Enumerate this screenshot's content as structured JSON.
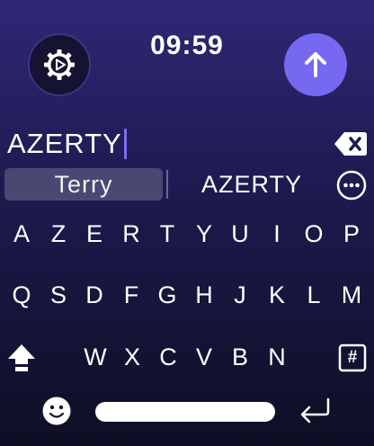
{
  "status": {
    "time": "09:59"
  },
  "toolbar": {
    "settings_icon": "gear-play-icon",
    "send_icon": "arrow-up-icon",
    "accent": "#7668f0"
  },
  "input": {
    "text": "AZERTY",
    "cursor_color": "#7c6df2"
  },
  "suggestions": {
    "selected": "Terry",
    "items": [
      "AZERTY"
    ],
    "more_icon": "ellipsis-icon"
  },
  "keyboard": {
    "rows": [
      [
        "A",
        "Z",
        "E",
        "R",
        "T",
        "Y",
        "U",
        "I",
        "O",
        "P"
      ],
      [
        "Q",
        "S",
        "D",
        "F",
        "G",
        "H",
        "J",
        "K",
        "L",
        "M"
      ],
      [
        "W",
        "X",
        "C",
        "V",
        "B",
        "N"
      ]
    ],
    "symbols_label": "#",
    "shift_icon": "shift-icon",
    "backspace_icon": "backspace-icon",
    "emoji_icon": "emoji-icon",
    "return_icon": "return-icon"
  }
}
